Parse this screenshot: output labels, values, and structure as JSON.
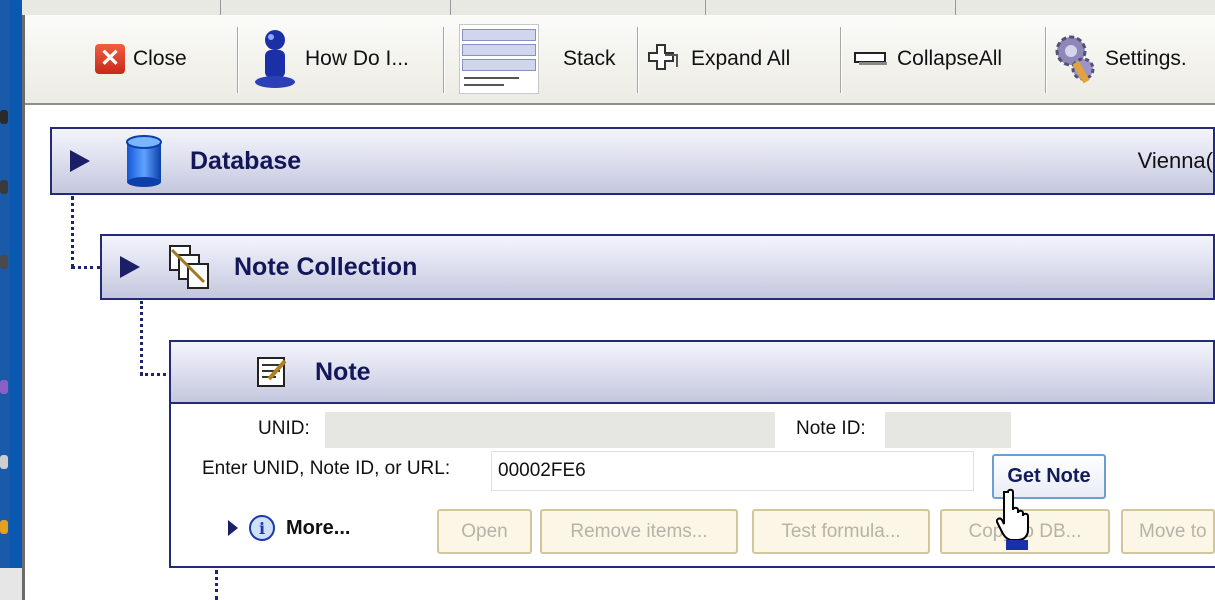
{
  "toolbar": {
    "close": "Close",
    "how_do_i": "How Do I...",
    "stack": "Stack",
    "expand_all": "Expand All",
    "collapse_all": "CollapseAll",
    "settings": "Settings."
  },
  "stack_thumb": {
    "row1": "Database",
    "row2": "Note Collection",
    "row3": "Note"
  },
  "panels": {
    "database": {
      "title": "Database",
      "server": "Vienna("
    },
    "note_collection": {
      "title": "Note Collection"
    },
    "note": {
      "title": "Note"
    }
  },
  "note_form": {
    "unid_label": "UNID:",
    "unid_value": "",
    "noteid_label": "Note ID:",
    "noteid_value": "",
    "enter_label": "Enter UNID, Note ID, or URL:",
    "enter_value": "00002FE6",
    "get_note": "Get Note",
    "more": "More..."
  },
  "actions": {
    "open": "Open",
    "remove_items": "Remove items...",
    "test_formula": "Test formula...",
    "copy_db": "Copy to DB...",
    "move_to": "Move to"
  },
  "colors": {
    "desktop": "#0b58b0",
    "panel_border": "#232a78",
    "panel_title": "#13175a",
    "get_note_border": "#6c9ed6"
  }
}
